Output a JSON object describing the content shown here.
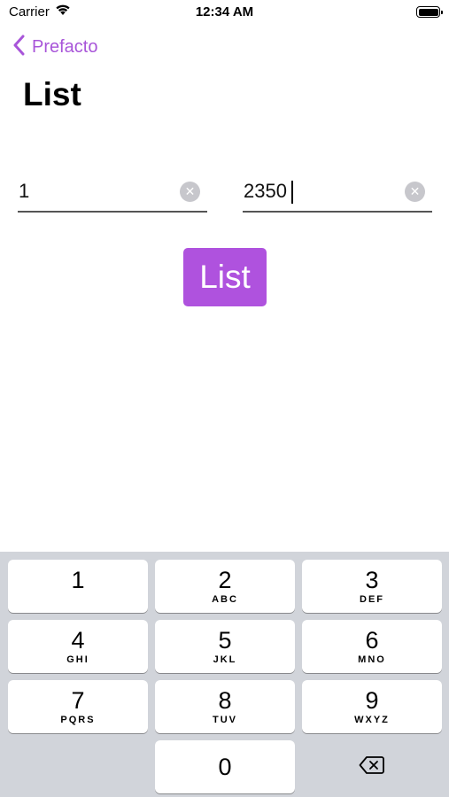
{
  "status_bar": {
    "carrier": "Carrier",
    "time": "12:34 AM",
    "icons": [
      "wifi-icon",
      "battery-icon"
    ]
  },
  "nav": {
    "back_label": "Prefacto",
    "title": "List"
  },
  "form": {
    "from_value": "1",
    "to_value": "2350",
    "button_label": "List"
  },
  "keypad": {
    "keys": [
      {
        "num": "1",
        "letters": ""
      },
      {
        "num": "2",
        "letters": "ABC"
      },
      {
        "num": "3",
        "letters": "DEF"
      },
      {
        "num": "4",
        "letters": "GHI"
      },
      {
        "num": "5",
        "letters": "JKL"
      },
      {
        "num": "6",
        "letters": "MNO"
      },
      {
        "num": "7",
        "letters": "PQRS"
      },
      {
        "num": "8",
        "letters": "TUV"
      },
      {
        "num": "9",
        "letters": "WXYZ"
      },
      {
        "num": "0",
        "letters": ""
      }
    ],
    "delete_icon": "delete-backspace-icon"
  },
  "colors": {
    "accent": "#af52de",
    "back_text": "#a855d9",
    "keypad_background": "#d1d4da"
  }
}
